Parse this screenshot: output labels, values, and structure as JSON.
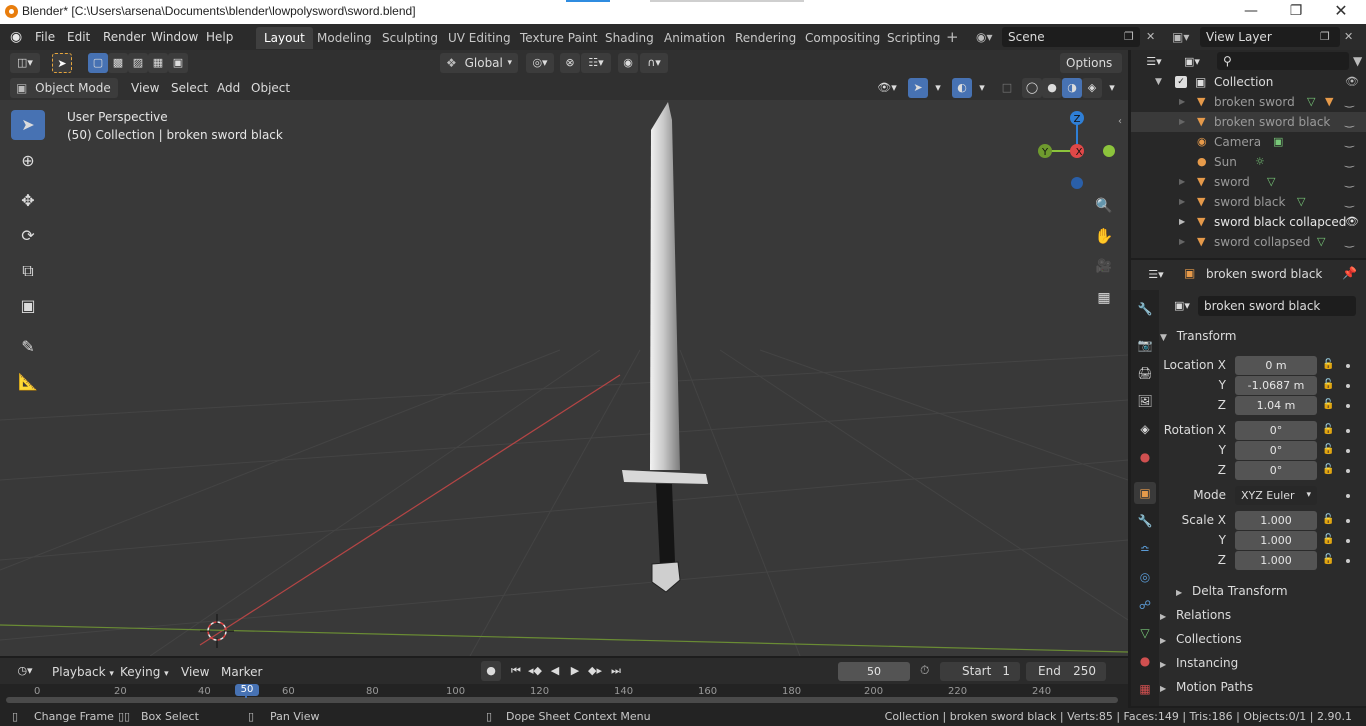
{
  "window": {
    "title": "Blender* [C:\\Users\\arsena\\Documents\\blender\\lowpolysword\\sword.blend]"
  },
  "menu": [
    "File",
    "Edit",
    "Render",
    "Window",
    "Help"
  ],
  "workspaces": [
    "Layout",
    "Modeling",
    "Sculpting",
    "UV Editing",
    "Texture Paint",
    "Shading",
    "Animation",
    "Rendering",
    "Compositing",
    "Scripting"
  ],
  "active_workspace": "Layout",
  "scene": {
    "label": "Scene",
    "view_layer": "View Layer"
  },
  "viewport_header": {
    "transform_orientation": "Global",
    "options": "Options",
    "mode": "Object Mode",
    "menus": [
      "View",
      "Select",
      "Add",
      "Object"
    ]
  },
  "viewport": {
    "perspective": "User Perspective",
    "info": "(50) Collection | broken sword black"
  },
  "gizmo": {
    "z": "Z",
    "y": "Y",
    "x": "X"
  },
  "outliner": {
    "collection": "Collection",
    "items": [
      {
        "name": "broken sword"
      },
      {
        "name": "broken sword black"
      },
      {
        "name": "Camera"
      },
      {
        "name": "Sun"
      },
      {
        "name": "sword"
      },
      {
        "name": "sword black"
      },
      {
        "name": "sword black collapced"
      },
      {
        "name": "sword collapsed"
      }
    ]
  },
  "properties": {
    "object_name": "broken sword black",
    "data_name": "broken sword black",
    "transform_title": "Transform",
    "location": {
      "label_x": "Location X",
      "x": "0 m",
      "y": "-1.0687 m",
      "z": "1.04 m"
    },
    "rotation": {
      "label_x": "Rotation X",
      "x": "0°",
      "y": "0°",
      "z": "0°"
    },
    "mode_label": "Mode",
    "mode": "XYZ Euler",
    "scale": {
      "label_x": "Scale X",
      "x": "1.000",
      "y": "1.000",
      "z": "1.000"
    },
    "axis_y": "Y",
    "axis_z": "Z",
    "delta": "Delta Transform",
    "sections": [
      "Relations",
      "Collections",
      "Instancing",
      "Motion Paths"
    ]
  },
  "timeline": {
    "menus": [
      "Playback",
      "Keying",
      "View",
      "Marker"
    ],
    "current_frame": "50",
    "start_label": "Start",
    "start": "1",
    "end_label": "End",
    "end": "250",
    "ticks": [
      "0",
      "20",
      "40",
      "50",
      "60",
      "80",
      "100",
      "120",
      "140",
      "160",
      "180",
      "200",
      "220",
      "240"
    ]
  },
  "statusbar": {
    "change_frame": "Change Frame",
    "box_select": "Box Select",
    "pan_view": "Pan View",
    "context_menu": "Dope Sheet Context Menu",
    "stats": "Collection | broken sword black | Verts:85 | Faces:149 | Tris:186 | Objects:0/1 | 2.90.1"
  },
  "colors": {
    "accent": "#4772b3",
    "viewport_bg": "#393939",
    "x_axis": "#e04848",
    "y_axis": "#8cc43c",
    "z_axis": "#2f7fd6"
  }
}
